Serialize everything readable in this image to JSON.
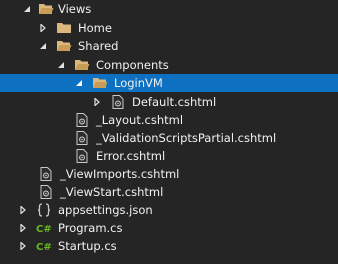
{
  "tree": {
    "views": "Views",
    "home": "Home",
    "shared": "Shared",
    "components": "Components",
    "loginvm": "LoginVM",
    "default_cshtml": "Default.cshtml",
    "layout_cshtml": "_Layout.cshtml",
    "validation_cshtml": "_ValidationScriptsPartial.cshtml",
    "error_cshtml": "Error.cshtml",
    "viewimports_cshtml": "_ViewImports.cshtml",
    "viewstart_cshtml": "_ViewStart.cshtml",
    "appsettings_json": "appsettings.json",
    "program_cs": "Program.cs",
    "startup_cs": "Startup.cs"
  },
  "icons": {
    "folder": "folder-icon",
    "folder_open": "folder-open-icon",
    "razor_file": "razor-file-icon",
    "json_file": "json-file-icon",
    "csharp_file": "csharp-file-icon",
    "expanded": "chevron-expanded-icon",
    "collapsed": "chevron-collapsed-icon"
  },
  "colors": {
    "background": "#252526",
    "selection": "#0e70c0",
    "text": "#f1f1f1",
    "folder": "#dcb67a",
    "csharp": "#68b723"
  }
}
